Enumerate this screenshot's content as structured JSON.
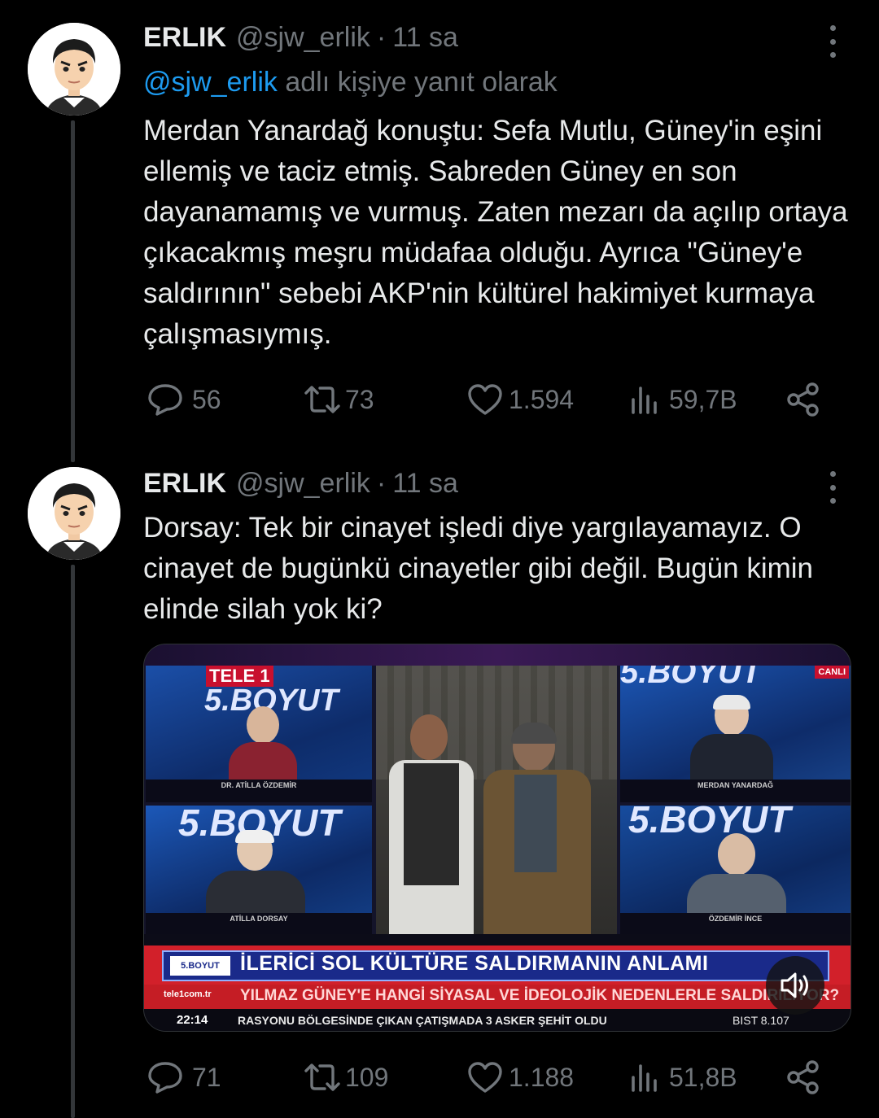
{
  "tweets": [
    {
      "name": "ERLIK",
      "handle": "@sjw_erlik",
      "separator": "·",
      "time": "11 sa",
      "reply_mention": "@sjw_erlik",
      "reply_suffix": " adlı kişiye yanıt olarak",
      "text": "Merdan Yanardağ konuştu: Sefa Mutlu, Güney'in eşini ellemiş ve taciz etmiş. Sabreden Güney en son dayanamamış ve vurmuş. Zaten mezarı da açılıp ortaya çıkacakmış meşru müdafaa olduğu. Ayrıca \"Güney'e saldırının\" sebebi AKP'nin kültürel hakimiyet kurmaya çalışmasıymış.",
      "replies": "56",
      "reposts": "73",
      "likes": "1.594",
      "views": "59,7B"
    },
    {
      "name": "ERLIK",
      "handle": "@sjw_erlik",
      "separator": "·",
      "time": "11 sa",
      "text": "Dorsay: Tek bir cinayet işledi diye yargılayamayız. O cinayet de bugünkü cinayetler gibi değil. Bugün kimin elinde silah yok ki?",
      "replies": "71",
      "reposts": "109",
      "likes": "1.188",
      "views": "51,8B"
    }
  ],
  "media": {
    "channel_logo": "TELE 1",
    "show_title": "5.BOYUT",
    "live_badge": "CANLI",
    "guests": [
      "DR. ATİLLA ÖZDEMİR",
      "MERDAN YANARDAĞ",
      "ATİLLA DORSAY",
      "ÖZDEMİR İNCE"
    ],
    "headline": "İLERİCİ SOL KÜLTÜRE SALDIRMANIN ANLAMI",
    "show_logo": "5.BOYUT",
    "sub_source": "tele1com.tr",
    "subheadline": "YILMAZ GÜNEY'E HANGİ SİYASAL VE İDEOLOJİK NEDENLERLE SALDIRILIYOR?",
    "clock": "22:14",
    "ticker": "RASYONU BÖLGESİNDE ÇIKAN ÇATIŞMADA 3 ASKER ŞEHİT OLDU",
    "market": "BIST 8.107"
  },
  "colors": {
    "background": "#000000",
    "text": "#e7e9ea",
    "muted": "#71767b",
    "link": "#1d9bf0",
    "thread_line": "#333639"
  },
  "icons": [
    "reply-icon",
    "repost-icon",
    "like-icon",
    "views-icon",
    "share-icon",
    "more-icon",
    "volume-icon"
  ]
}
